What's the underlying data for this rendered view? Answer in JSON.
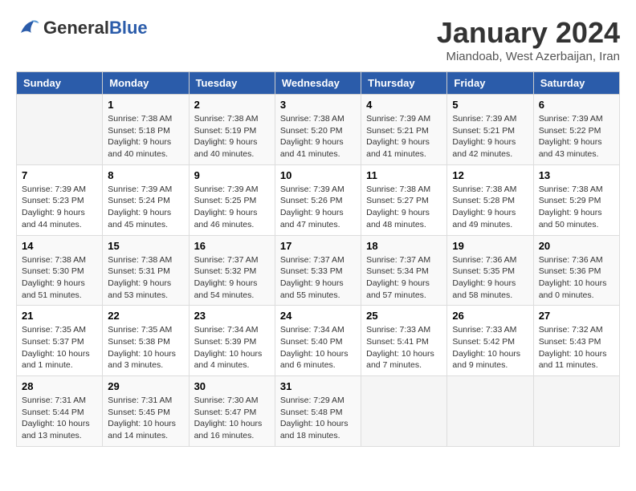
{
  "header": {
    "logo_general": "General",
    "logo_blue": "Blue",
    "month_title": "January 2024",
    "location": "Miandoab, West Azerbaijan, Iran"
  },
  "days_of_week": [
    "Sunday",
    "Monday",
    "Tuesday",
    "Wednesday",
    "Thursday",
    "Friday",
    "Saturday"
  ],
  "weeks": [
    [
      {
        "day": "",
        "info": ""
      },
      {
        "day": "1",
        "info": "Sunrise: 7:38 AM\nSunset: 5:18 PM\nDaylight: 9 hours\nand 40 minutes."
      },
      {
        "day": "2",
        "info": "Sunrise: 7:38 AM\nSunset: 5:19 PM\nDaylight: 9 hours\nand 40 minutes."
      },
      {
        "day": "3",
        "info": "Sunrise: 7:38 AM\nSunset: 5:20 PM\nDaylight: 9 hours\nand 41 minutes."
      },
      {
        "day": "4",
        "info": "Sunrise: 7:39 AM\nSunset: 5:21 PM\nDaylight: 9 hours\nand 41 minutes."
      },
      {
        "day": "5",
        "info": "Sunrise: 7:39 AM\nSunset: 5:21 PM\nDaylight: 9 hours\nand 42 minutes."
      },
      {
        "day": "6",
        "info": "Sunrise: 7:39 AM\nSunset: 5:22 PM\nDaylight: 9 hours\nand 43 minutes."
      }
    ],
    [
      {
        "day": "7",
        "info": "Sunrise: 7:39 AM\nSunset: 5:23 PM\nDaylight: 9 hours\nand 44 minutes."
      },
      {
        "day": "8",
        "info": "Sunrise: 7:39 AM\nSunset: 5:24 PM\nDaylight: 9 hours\nand 45 minutes."
      },
      {
        "day": "9",
        "info": "Sunrise: 7:39 AM\nSunset: 5:25 PM\nDaylight: 9 hours\nand 46 minutes."
      },
      {
        "day": "10",
        "info": "Sunrise: 7:39 AM\nSunset: 5:26 PM\nDaylight: 9 hours\nand 47 minutes."
      },
      {
        "day": "11",
        "info": "Sunrise: 7:38 AM\nSunset: 5:27 PM\nDaylight: 9 hours\nand 48 minutes."
      },
      {
        "day": "12",
        "info": "Sunrise: 7:38 AM\nSunset: 5:28 PM\nDaylight: 9 hours\nand 49 minutes."
      },
      {
        "day": "13",
        "info": "Sunrise: 7:38 AM\nSunset: 5:29 PM\nDaylight: 9 hours\nand 50 minutes."
      }
    ],
    [
      {
        "day": "14",
        "info": "Sunrise: 7:38 AM\nSunset: 5:30 PM\nDaylight: 9 hours\nand 51 minutes."
      },
      {
        "day": "15",
        "info": "Sunrise: 7:38 AM\nSunset: 5:31 PM\nDaylight: 9 hours\nand 53 minutes."
      },
      {
        "day": "16",
        "info": "Sunrise: 7:37 AM\nSunset: 5:32 PM\nDaylight: 9 hours\nand 54 minutes."
      },
      {
        "day": "17",
        "info": "Sunrise: 7:37 AM\nSunset: 5:33 PM\nDaylight: 9 hours\nand 55 minutes."
      },
      {
        "day": "18",
        "info": "Sunrise: 7:37 AM\nSunset: 5:34 PM\nDaylight: 9 hours\nand 57 minutes."
      },
      {
        "day": "19",
        "info": "Sunrise: 7:36 AM\nSunset: 5:35 PM\nDaylight: 9 hours\nand 58 minutes."
      },
      {
        "day": "20",
        "info": "Sunrise: 7:36 AM\nSunset: 5:36 PM\nDaylight: 10 hours\nand 0 minutes."
      }
    ],
    [
      {
        "day": "21",
        "info": "Sunrise: 7:35 AM\nSunset: 5:37 PM\nDaylight: 10 hours\nand 1 minute."
      },
      {
        "day": "22",
        "info": "Sunrise: 7:35 AM\nSunset: 5:38 PM\nDaylight: 10 hours\nand 3 minutes."
      },
      {
        "day": "23",
        "info": "Sunrise: 7:34 AM\nSunset: 5:39 PM\nDaylight: 10 hours\nand 4 minutes."
      },
      {
        "day": "24",
        "info": "Sunrise: 7:34 AM\nSunset: 5:40 PM\nDaylight: 10 hours\nand 6 minutes."
      },
      {
        "day": "25",
        "info": "Sunrise: 7:33 AM\nSunset: 5:41 PM\nDaylight: 10 hours\nand 7 minutes."
      },
      {
        "day": "26",
        "info": "Sunrise: 7:33 AM\nSunset: 5:42 PM\nDaylight: 10 hours\nand 9 minutes."
      },
      {
        "day": "27",
        "info": "Sunrise: 7:32 AM\nSunset: 5:43 PM\nDaylight: 10 hours\nand 11 minutes."
      }
    ],
    [
      {
        "day": "28",
        "info": "Sunrise: 7:31 AM\nSunset: 5:44 PM\nDaylight: 10 hours\nand 13 minutes."
      },
      {
        "day": "29",
        "info": "Sunrise: 7:31 AM\nSunset: 5:45 PM\nDaylight: 10 hours\nand 14 minutes."
      },
      {
        "day": "30",
        "info": "Sunrise: 7:30 AM\nSunset: 5:47 PM\nDaylight: 10 hours\nand 16 minutes."
      },
      {
        "day": "31",
        "info": "Sunrise: 7:29 AM\nSunset: 5:48 PM\nDaylight: 10 hours\nand 18 minutes."
      },
      {
        "day": "",
        "info": ""
      },
      {
        "day": "",
        "info": ""
      },
      {
        "day": "",
        "info": ""
      }
    ]
  ]
}
